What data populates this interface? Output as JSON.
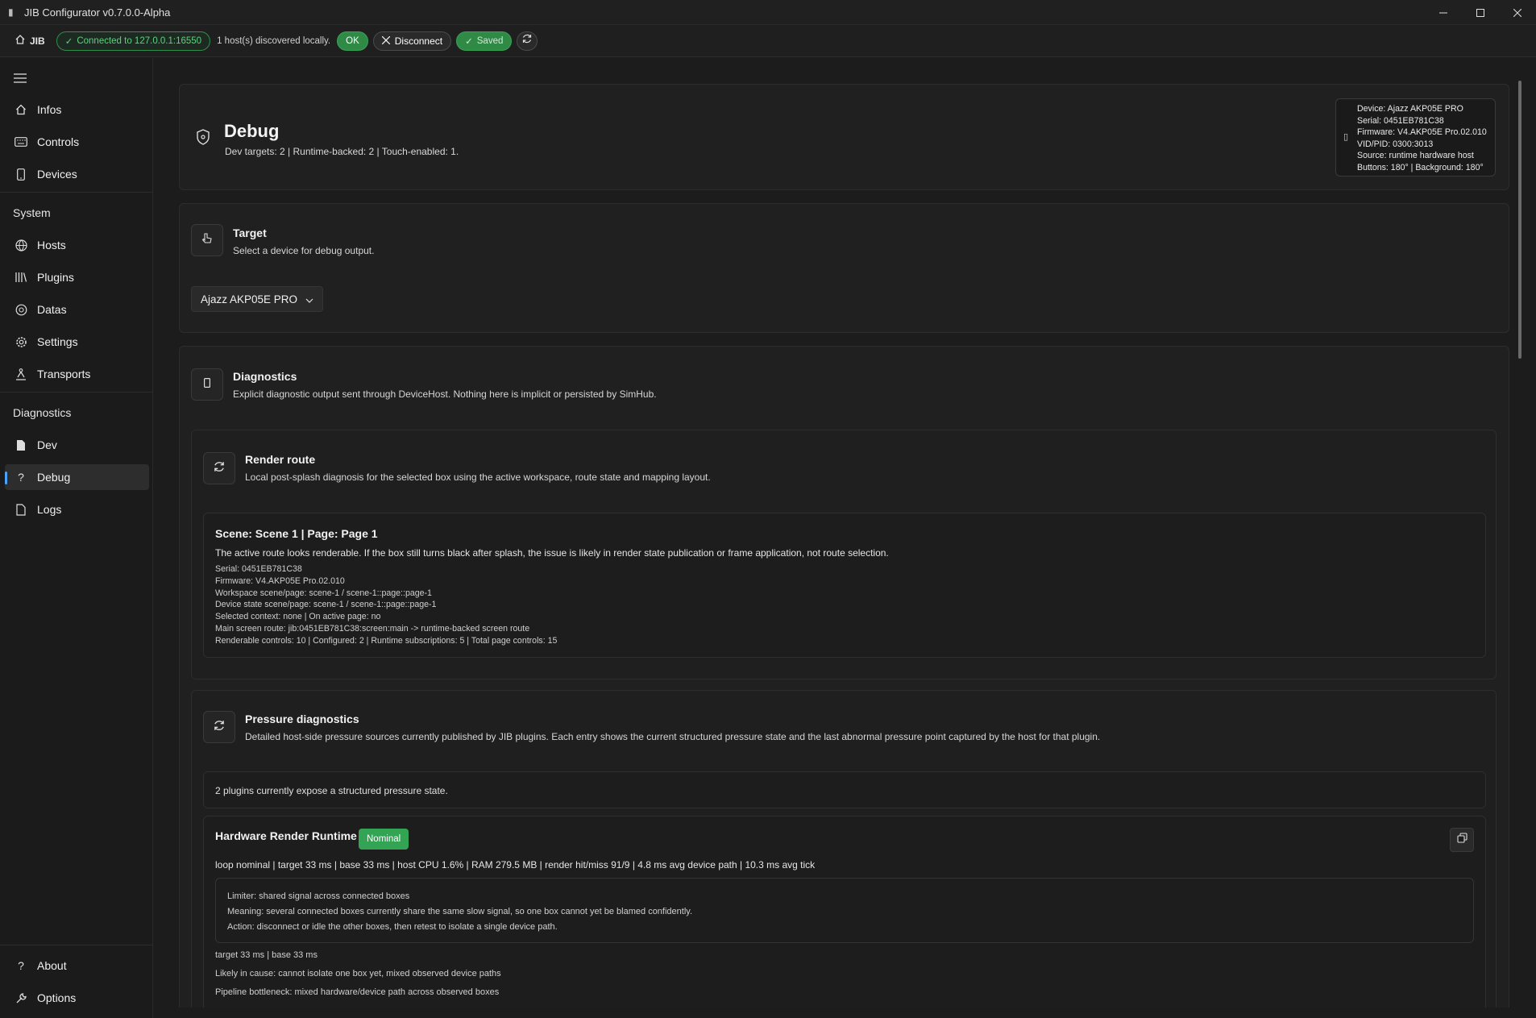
{
  "window": {
    "title": "JIB Configurator v0.7.0.0-Alpha"
  },
  "toolbar": {
    "home_label": "JIB",
    "connection": "Connected to 127.0.0.1:16550",
    "hosts_text": "1 host(s) discovered locally.",
    "ok_label": "OK",
    "disconnect_label": "Disconnect",
    "saved_label": "Saved"
  },
  "sidebar": {
    "top_items": [
      {
        "label": "Infos",
        "icon": "home-icon"
      },
      {
        "label": "Controls",
        "icon": "keyboard-icon"
      },
      {
        "label": "Devices",
        "icon": "phone-icon"
      }
    ],
    "system_label": "System",
    "system_items": [
      {
        "label": "Hosts",
        "icon": "globe-icon"
      },
      {
        "label": "Plugins",
        "icon": "library-icon"
      },
      {
        "label": "Datas",
        "icon": "data-icon"
      },
      {
        "label": "Settings",
        "icon": "gear-icon"
      },
      {
        "label": "Transports",
        "icon": "transport-icon"
      }
    ],
    "diagnostics_label": "Diagnostics",
    "diagnostics_items": [
      {
        "label": "Dev",
        "icon": "file-icon"
      },
      {
        "label": "Debug",
        "icon": "question-icon",
        "active": true
      },
      {
        "label": "Logs",
        "icon": "document-icon"
      }
    ],
    "bottom_items": [
      {
        "label": "About",
        "icon": "question-icon"
      },
      {
        "label": "Options",
        "icon": "wrench-icon"
      }
    ]
  },
  "page": {
    "title": "Debug",
    "subtitle": "Dev targets: 2  |  Runtime-backed: 2  |  Touch-enabled: 1.",
    "device_info": [
      "Device: Ajazz AKP05E PRO",
      "Serial: 0451EB781C38",
      "Firmware: V4.AKP05E Pro.02.010",
      "VID/PID: 0300:3013",
      "Source: runtime hardware host",
      "Buttons: 180° | Background: 180°"
    ]
  },
  "target": {
    "title": "Target",
    "subtitle": "Select a device for debug output.",
    "selected": "Ajazz AKP05E PRO"
  },
  "diagnostics": {
    "title": "Diagnostics",
    "subtitle": "Explicit diagnostic output sent through DeviceHost. Nothing here is implicit or persisted by SimHub."
  },
  "render_route": {
    "title": "Render route",
    "subtitle": "Local post-splash diagnosis for the selected box using the active workspace, route state and mapping layout.",
    "scene_line": "Scene: Scene 1  |  Page: Page 1",
    "summary": "The active route looks renderable. If the box still turns black after splash, the issue is likely in render state publication or frame application, not route selection.",
    "lines": [
      "Serial: 0451EB781C38",
      "Firmware: V4.AKP05E Pro.02.010",
      "Workspace scene/page: scene-1 / scene-1::page::page-1",
      "Device state scene/page: scene-1 / scene-1::page::page-1",
      "Selected context: none  |  On active page: no",
      "Main screen route: jib:0451EB781C38:screen:main -> runtime-backed screen route",
      "Renderable controls: 10  |  Configured: 2  |  Runtime subscriptions: 5  |  Total page controls: 15"
    ]
  },
  "pressure": {
    "title": "Pressure diagnostics",
    "subtitle": "Detailed host-side pressure sources currently published by JIB plugins. Each entry shows the current structured pressure state and the last abnormal pressure point captured by the host for that plugin.",
    "summary": "2 plugins currently expose a structured pressure state.",
    "entry": {
      "title": "Hardware Render Runtime",
      "badge": "Nominal",
      "badge_color": "#33a354",
      "metrics": "loop nominal | target 33 ms | base 33 ms | host CPU 1.6% | RAM 279.5 MB | render hit/miss 91/9 | 4.8 ms avg device path | 10.3 ms avg tick",
      "limiter_lines": [
        "Limiter: shared signal across connected boxes",
        "Meaning: several connected boxes currently share the same slow signal, so one box cannot yet be blamed confidently.",
        "Action: disconnect or idle the other boxes, then retest to isolate a single device path."
      ],
      "footer_lines": [
        "target 33 ms | base 33 ms",
        "Likely in cause: cannot isolate one box yet, mixed observed device paths",
        "Pipeline bottleneck: mixed hardware/device path across observed boxes"
      ]
    }
  },
  "colors": {
    "accent": "#4aa3ff",
    "success": "#2f8a45",
    "background": "#1c1c1c"
  }
}
